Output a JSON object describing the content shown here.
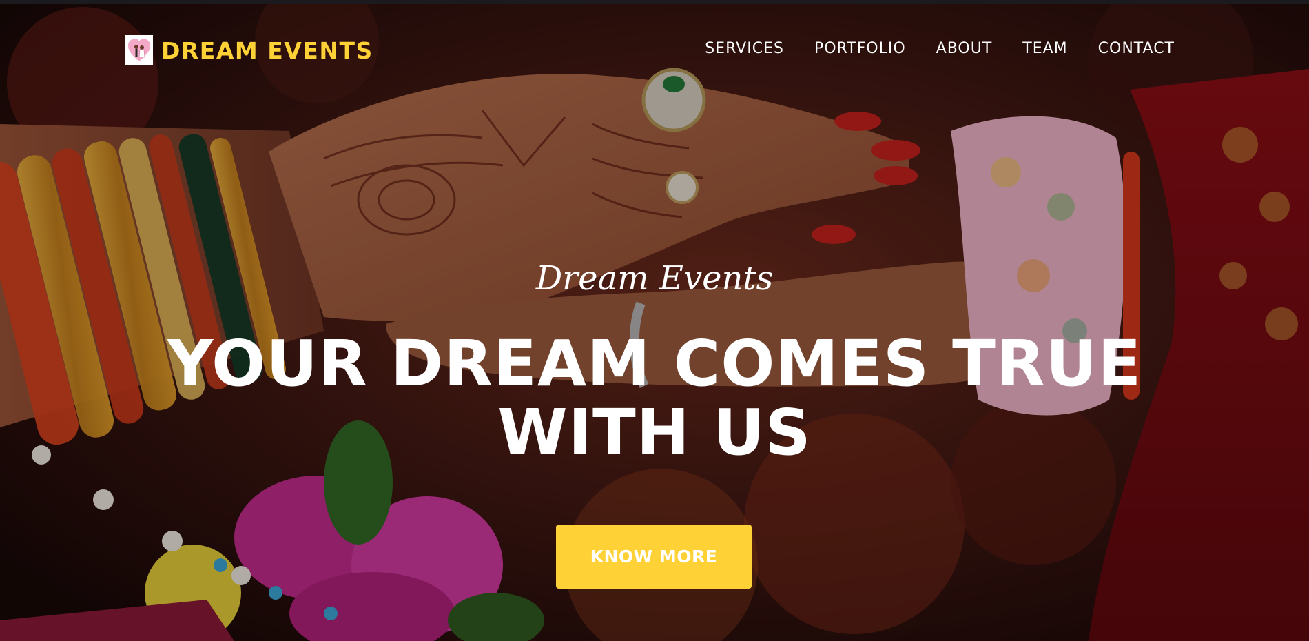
{
  "brand": {
    "name": "DREAM EVENTS",
    "logo_icon": "heart-couple-icon",
    "color": "#fed136"
  },
  "nav": {
    "items": [
      {
        "label": "SERVICES"
      },
      {
        "label": "PORTFOLIO"
      },
      {
        "label": "ABOUT"
      },
      {
        "label": "TEAM"
      },
      {
        "label": "CONTACT"
      }
    ]
  },
  "hero": {
    "subheading": "Dream Events",
    "heading_line1": "YOUR DREAM COMES TRUE",
    "heading_line2": "WITH US",
    "cta_label": "KNOW MORE",
    "cta_color": "#fed136",
    "background_image": "wedding-hands-mehndi-photo"
  }
}
